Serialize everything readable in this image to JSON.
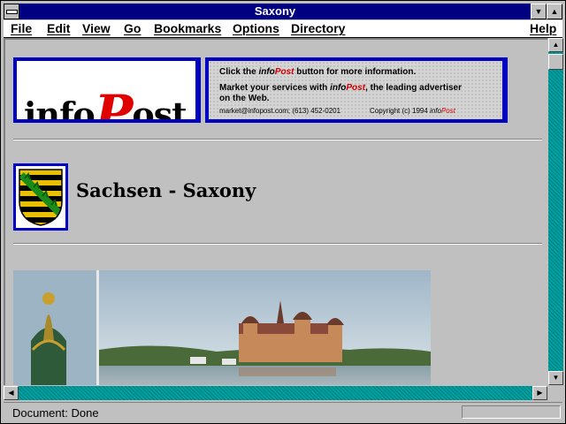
{
  "window": {
    "title": "Saxony",
    "minimize_glyph": "▼",
    "maximize_glyph": "▲"
  },
  "menubar": {
    "items": [
      "File",
      "Edit",
      "View",
      "Go",
      "Bookmarks",
      "Options",
      "Directory"
    ],
    "help": "Help"
  },
  "banner": {
    "logo_prefix": "info",
    "logo_p": "P",
    "logo_suffix": "ost",
    "line1_pre": "Click the ",
    "line1_brand_info": "info",
    "line1_brand_post": "Post",
    "line1_post": " button for more information.",
    "line2_pre": "Market your services with ",
    "line2_brand_info": "info",
    "line2_brand_post": "Post",
    "line2_post": ", the leading advertiser",
    "line3": "on the Web.",
    "contact": "market@infopost.com; (613) 452-0201",
    "copyright_pre": "Copyright (c) 1994 ",
    "copyright_brand_info": "info",
    "copyright_brand_post": "Post"
  },
  "page": {
    "heading": "Sachsen - Saxony"
  },
  "status": {
    "text": "Document: Done"
  },
  "icons": {
    "system_menu": "system-menu-icon",
    "scroll_up": "arrow-up-icon",
    "scroll_down": "arrow-down-icon",
    "scroll_left": "arrow-left-icon",
    "scroll_right": "arrow-right-icon"
  },
  "colors": {
    "titlebar": "#000080",
    "accent_red": "#e00000",
    "frame_blue": "#0000c0",
    "scroll_teal": "#00a0a0"
  }
}
